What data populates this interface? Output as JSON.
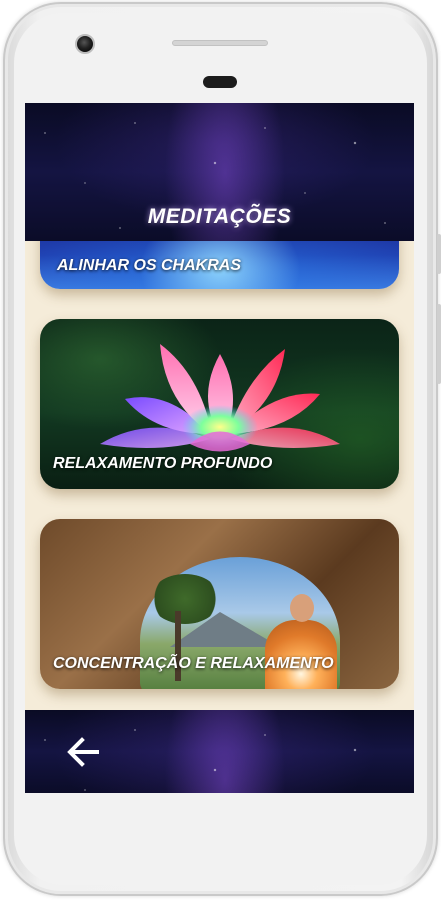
{
  "header": {
    "title": "MEDITAÇÕES"
  },
  "meditations": [
    {
      "label": "ALINHAR OS CHAKRAS"
    },
    {
      "label": "RELAXAMENTO PROFUNDO"
    },
    {
      "label": "CONCENTRAÇÃO E RELAXAMENTO"
    }
  ],
  "footer": {
    "back_icon": "arrow-left-icon"
  },
  "colors": {
    "background": "#f5ecd9",
    "header_bg": "#0a0b24",
    "label_text": "#ffffff"
  }
}
